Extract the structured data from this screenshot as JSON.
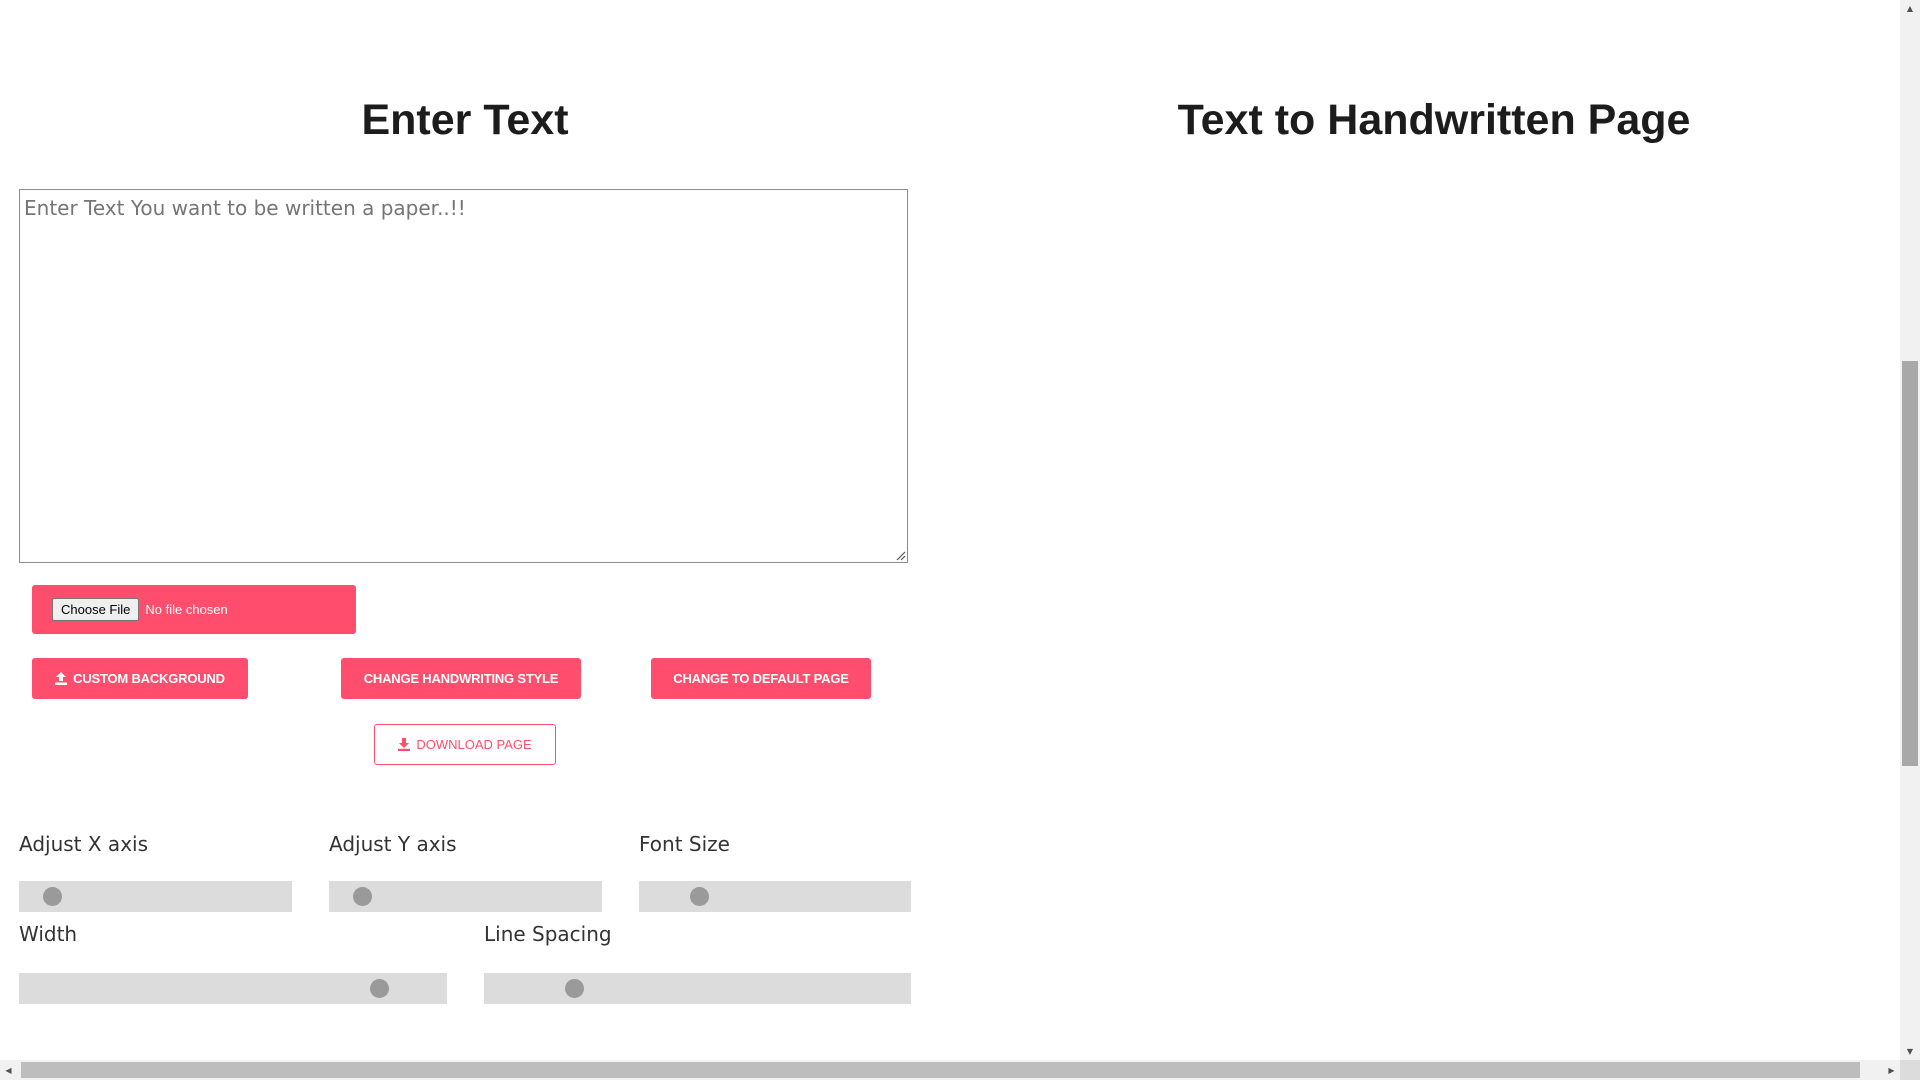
{
  "headings": {
    "left": "Enter Text",
    "right": "Text to Handwritten Page"
  },
  "editor": {
    "placeholder": "Enter Text You want to be written a paper..!!",
    "value": ""
  },
  "file_input": {
    "button_label": "Choose File",
    "status": "No file chosen"
  },
  "buttons": {
    "custom_background": "Custom Background",
    "change_style": "Change Handwriting Style",
    "default_page": "Change to Default Page",
    "download": "Download Page"
  },
  "sliders": {
    "x_axis": {
      "label": "Adjust X axis",
      "value_fraction": 0.12
    },
    "y_axis": {
      "label": "Adjust Y axis",
      "value_fraction": 0.12
    },
    "font_size": {
      "label": "Font Size",
      "value_fraction": 0.22
    },
    "width": {
      "label": "Width",
      "value_fraction": 0.84
    },
    "line_spacing": {
      "label": "Line Spacing",
      "value_fraction": 0.21
    }
  },
  "colors": {
    "accent": "#ff4d6d",
    "heading": "#1c1c1c",
    "track": "#dcdcdc",
    "thumb": "#9a9a9a"
  },
  "icons": {
    "custom_background": "upload-icon",
    "download": "download-icon"
  }
}
